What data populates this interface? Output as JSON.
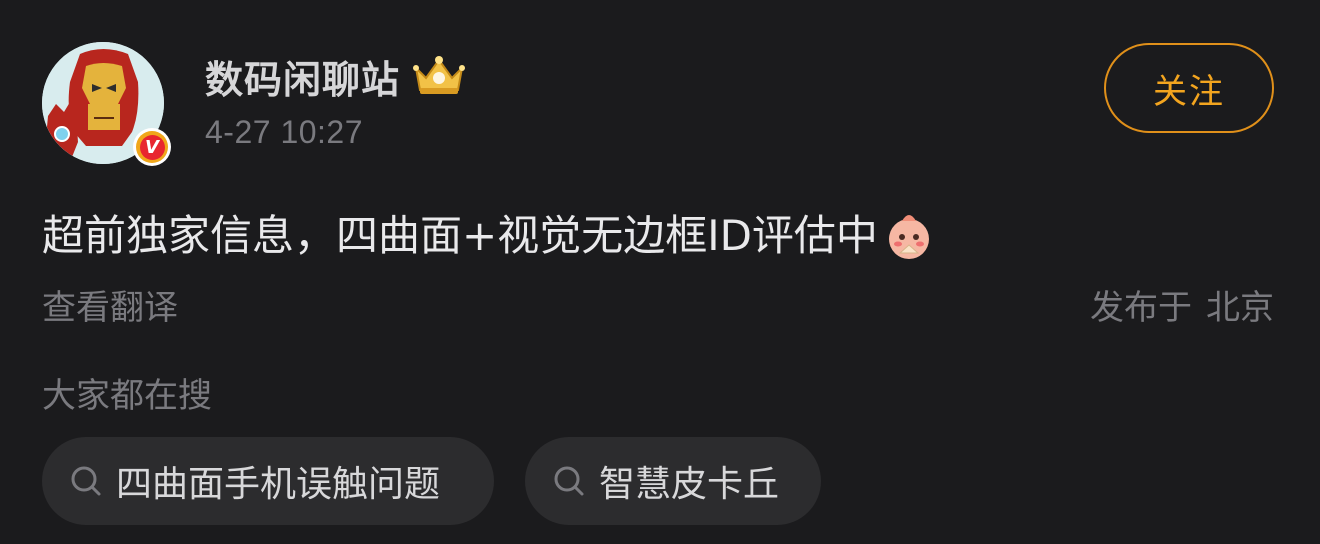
{
  "post": {
    "username": "数码闲聊站",
    "timestamp": "4-27 10:27",
    "follow_label": "关注",
    "verified_badge": "V",
    "content_text": "超前独家信息，四曲面+视觉无边框ID评估中",
    "translate_label": "查看翻译",
    "location_prefix": "发布于",
    "location_city": "北京"
  },
  "trending": {
    "label": "大家都在搜",
    "chips": [
      {
        "text": "四曲面手机误触问题"
      },
      {
        "text": "智慧皮卡丘"
      }
    ]
  },
  "colors": {
    "background": "#1b1b1d",
    "accent": "#f3a51f",
    "chip_background": "#2c2c2e",
    "muted_text": "#7a7a7f"
  },
  "icons": {
    "avatar": "iron-man-avatar",
    "crown": "crown-icon",
    "verified": "verified-badge-icon",
    "emoji": "shy-emoji-icon",
    "search": "search-icon"
  }
}
